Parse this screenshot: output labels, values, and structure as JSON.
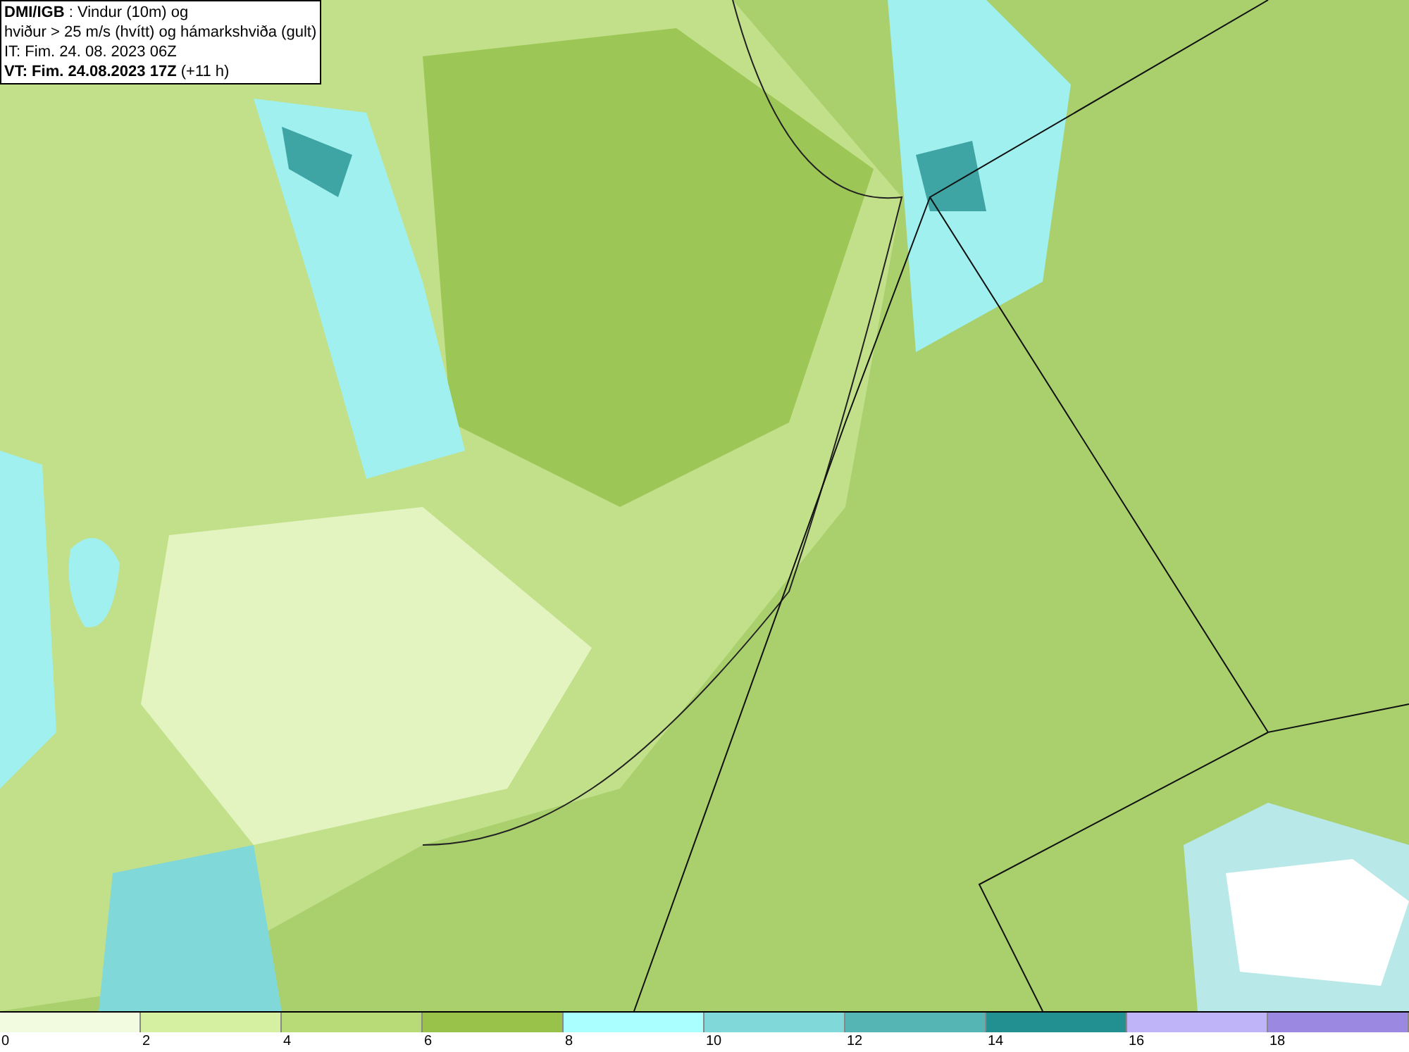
{
  "header": {
    "lines": [
      "**DMI/IGB** : Vindur (10m) og",
      "hviður > 25 m/s (hvítt) og hámarkshviða (gult)",
      "IT: Fim. 24. 08. 2023 06Z",
      "**VT: Fim. 24.08.2023 17Z** (+11 h)"
    ]
  },
  "legend": {
    "swatches": [
      {
        "color": "#f2fbe0",
        "label": "0"
      },
      {
        "color": "#d5f0a0",
        "label": "2"
      },
      {
        "color": "#b8db78",
        "label": "4"
      },
      {
        "color": "#98c24a",
        "label": "6"
      },
      {
        "color": "#aaffff",
        "label": "8"
      },
      {
        "color": "#80d8d8",
        "label": "10"
      },
      {
        "color": "#55b4b4",
        "label": "12"
      },
      {
        "color": "#229090",
        "label": "14"
      },
      {
        "color": "#c0b4f8",
        "label": "16"
      },
      {
        "color": "#9b88e0",
        "label": "18"
      }
    ]
  }
}
